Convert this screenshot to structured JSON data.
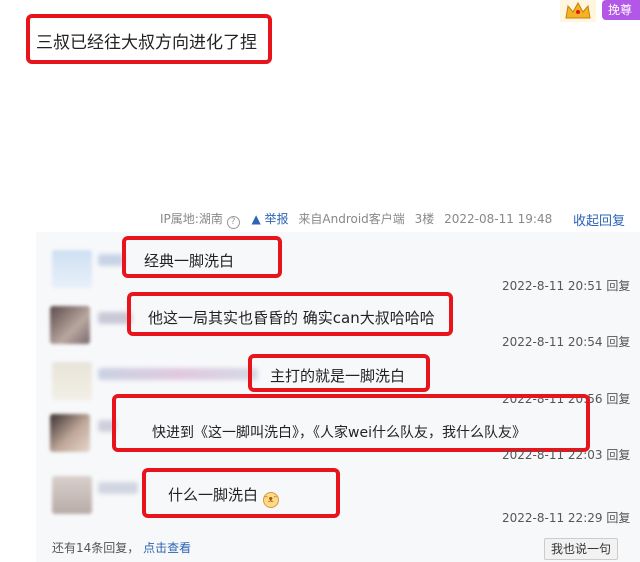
{
  "post": {
    "text": "三叔已经往大叔方向进化了捏",
    "ip_label": "IP属地:湖南",
    "report_label": "举报",
    "client": "来自Android客户端",
    "floor": "3楼",
    "datetime": "2022-08-11 19:48",
    "collapse_label": "收起回复"
  },
  "corner_button": {
    "label": "挽尊"
  },
  "replies": [
    {
      "text": "经典一脚洗白",
      "time": "2022-8-11 20:51",
      "reply_label": "回复"
    },
    {
      "text": "他这一局其实也昏昏的 确实can大叔哈哈哈",
      "time": "2022-8-11 20:54",
      "reply_label": "回复"
    },
    {
      "text": "主打的就是一脚洗白",
      "time": "2022-8-11 20:56",
      "reply_label": "回复"
    },
    {
      "text": "快进到《这一脚叫洗白》，《人家wei什么队友，我什么队友》",
      "time": "2022-8-11 22:03",
      "reply_label": "回复"
    },
    {
      "text": "什么一脚洗白",
      "time": "2022-8-11 22:29",
      "reply_label": "回复"
    }
  ],
  "footer": {
    "more_text": "还有14条回复，",
    "view_link": "点击查看",
    "say_button": "我也说一句"
  },
  "icons": {
    "crown": "crown-icon",
    "warning": "warning-icon",
    "help": "help-circle-icon",
    "smile": "smile-emoji-icon"
  },
  "colors": {
    "highlight_box": "#e8141b",
    "link": "#2d64b3",
    "badge_purple": "#b357e6"
  }
}
